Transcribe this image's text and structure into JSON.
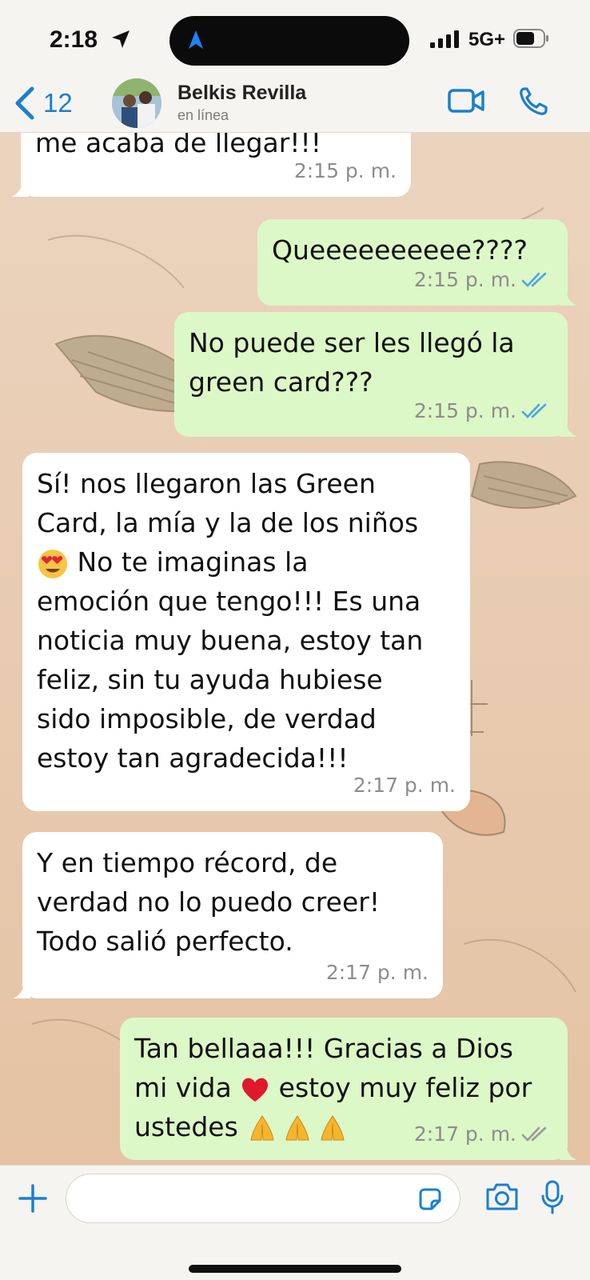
{
  "status_bar": {
    "time": "2:18",
    "network": "5G+"
  },
  "header": {
    "back_count": "12",
    "contact_name": "Belkis Revilla",
    "contact_status": "en línea"
  },
  "messages": [
    {
      "direction": "incoming",
      "text": "me acaba de llegar!!!",
      "time": "2:15 p. m."
    },
    {
      "direction": "outgoing",
      "text": "Queeeeeeeeee????",
      "time": "2:15 p. m.",
      "status": "read"
    },
    {
      "direction": "outgoing",
      "text": "No puede ser les llegó la\ngreen card???",
      "time": "2:15 p. m.",
      "status": "read"
    },
    {
      "direction": "incoming",
      "text_before_emoji": "Sí! nos llegaron las Green\nCard, la mía y la de los niños\n",
      "emoji": "heart-eyes-emoji",
      "text_after_emoji": "  No te imaginas la\nemoción que tengo!!! Es una\nnoticia muy buena, estoy tan\nfeliz, sin tu ayuda hubiese\nsido imposible, de verdad\nestoy tan agradecida!!!",
      "time": "2:17 p. m."
    },
    {
      "direction": "incoming",
      "text": "Y en tiempo récord, de\nverdad no lo puedo creer!\nTodo salió perfecto.",
      "time": "2:17 p. m."
    },
    {
      "direction": "outgoing",
      "text_line1": "Tan bellaaa!!! Gracias a Dios",
      "text_line2_before": "mi vida ",
      "emoji_heart": "red-heart-emoji",
      "text_line2_after": " estoy muy feliz por",
      "text_line3": "ustedes ",
      "emoji_pray": "folded-hands-emoji",
      "time": "2:17 p. m.",
      "status": "delivered"
    }
  ],
  "colors": {
    "accent": "#1a7fd0",
    "incoming_bubble": "#ffffff",
    "outgoing_bubble": "#dcf8c6",
    "read_ticks": "#4fa3e6",
    "delivered_ticks": "#9a9a9a"
  }
}
